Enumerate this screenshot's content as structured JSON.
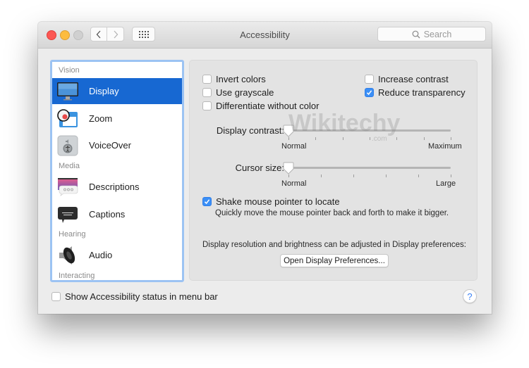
{
  "window": {
    "title": "Accessibility",
    "search_placeholder": "Search",
    "icons": {
      "back": "chevron-left-icon",
      "forward": "chevron-right-icon",
      "show_all": "grid-icon",
      "search": "magnifier-icon",
      "help": "question-mark-icon"
    }
  },
  "sidebar": {
    "sections": [
      {
        "label": "Vision"
      },
      {
        "label": "Media"
      },
      {
        "label": "Hearing"
      },
      {
        "label": "Interacting"
      }
    ],
    "items": [
      {
        "label": "Display",
        "icon": "monitor-icon",
        "selected": true
      },
      {
        "label": "Zoom",
        "icon": "zoom-icon",
        "selected": false
      },
      {
        "label": "VoiceOver",
        "icon": "voiceover-icon",
        "selected": false
      },
      {
        "label": "Descriptions",
        "icon": "descriptions-icon",
        "selected": false
      },
      {
        "label": "Captions",
        "icon": "captions-icon",
        "selected": false
      },
      {
        "label": "Audio",
        "icon": "speaker-icon",
        "selected": false
      }
    ]
  },
  "display_panel": {
    "checkboxes_left": [
      {
        "label": "Invert colors",
        "checked": false
      },
      {
        "label": "Use grayscale",
        "checked": false
      },
      {
        "label": "Differentiate without color",
        "checked": false
      }
    ],
    "checkboxes_right": [
      {
        "label": "Increase contrast",
        "checked": false
      },
      {
        "label": "Reduce transparency",
        "checked": true
      }
    ],
    "display_contrast": {
      "label": "Display contrast:",
      "min_label": "Normal",
      "max_label": "Maximum",
      "value_fraction": 0
    },
    "cursor_size": {
      "label": "Cursor size:",
      "min_label": "Normal",
      "max_label": "Large",
      "value_fraction": 0
    },
    "shake_pointer": {
      "label": "Shake mouse pointer to locate",
      "checked": true,
      "description": "Quickly move the mouse pointer back and forth to make it bigger."
    },
    "resolution_note": "Display resolution and brightness can be adjusted in Display preferences:",
    "open_display_button": "Open Display Preferences..."
  },
  "footer": {
    "status_checkbox": {
      "label": "Show Accessibility status in menu bar",
      "checked": false
    },
    "help_label": "?"
  },
  "watermark": {
    "text": "Wikitechy",
    "sub": ".com"
  }
}
